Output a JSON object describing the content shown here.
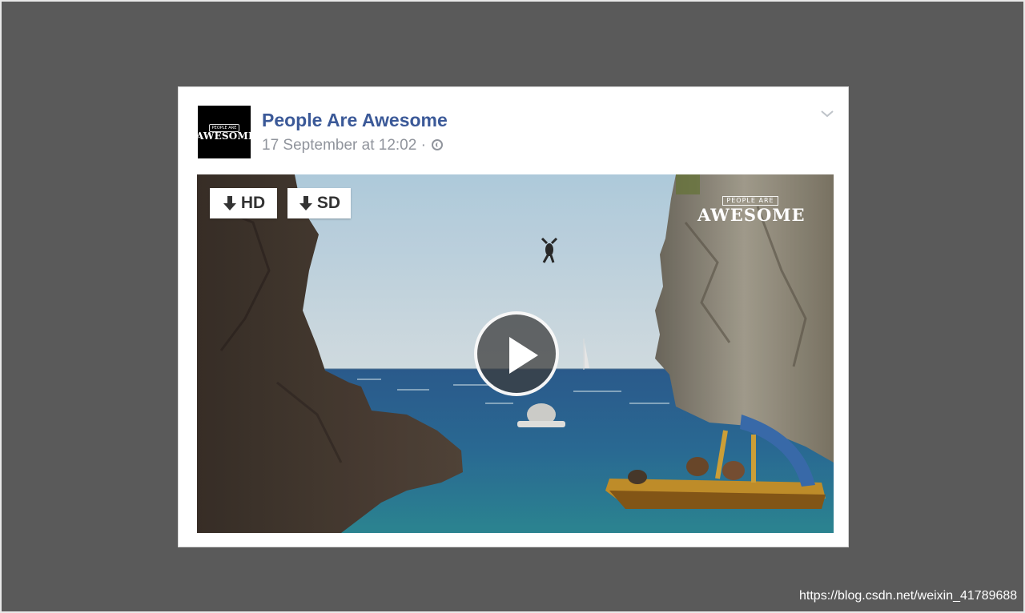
{
  "post": {
    "page_name": "People Are Awesome",
    "timestamp": "17 September at 12:02",
    "separator": "·",
    "privacy_icon": "globe-icon",
    "menu_icon": "chevron-down-icon"
  },
  "avatar": {
    "small_text": "PEOPLE ARE",
    "big_text": "AWESOME"
  },
  "video": {
    "watermark_small": "PEOPLE ARE",
    "watermark_big": "AWESOME",
    "play_icon": "play-icon",
    "download_buttons": [
      {
        "label": "HD",
        "icon": "download-arrow-icon"
      },
      {
        "label": "SD",
        "icon": "download-arrow-icon"
      }
    ]
  },
  "footer": {
    "source_url": "https://blog.csdn.net/weixin_41789688"
  },
  "colors": {
    "background": "#5a5a5a",
    "link_blue": "#3b5998",
    "meta_gray": "#90949c"
  }
}
